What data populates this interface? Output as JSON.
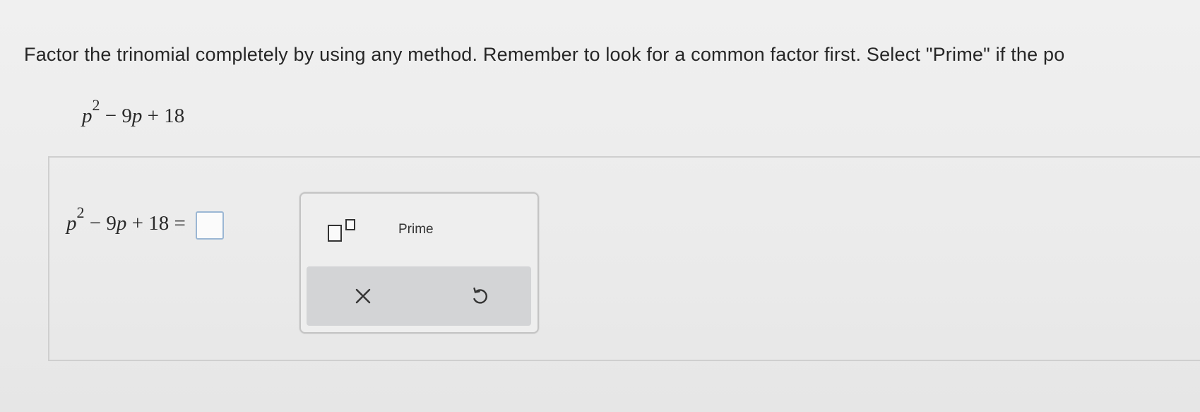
{
  "question": {
    "instructions": "Factor the trinomial completely by using any method. Remember to look for a common factor first. Select \"Prime\" if the po",
    "expression": {
      "variable": "p",
      "exponent": "2",
      "middle": "− 9",
      "middle_var": "p",
      "tail": "+ 18"
    }
  },
  "answer": {
    "lhs": {
      "variable": "p",
      "exponent": "2",
      "middle": "− 9",
      "middle_var": "p",
      "tail": "+ 18",
      "equals": "="
    },
    "value": ""
  },
  "palette": {
    "exponent_button": "exponent-template",
    "prime_label": "Prime",
    "clear_icon": "close-icon",
    "undo_icon": "undo-icon"
  }
}
